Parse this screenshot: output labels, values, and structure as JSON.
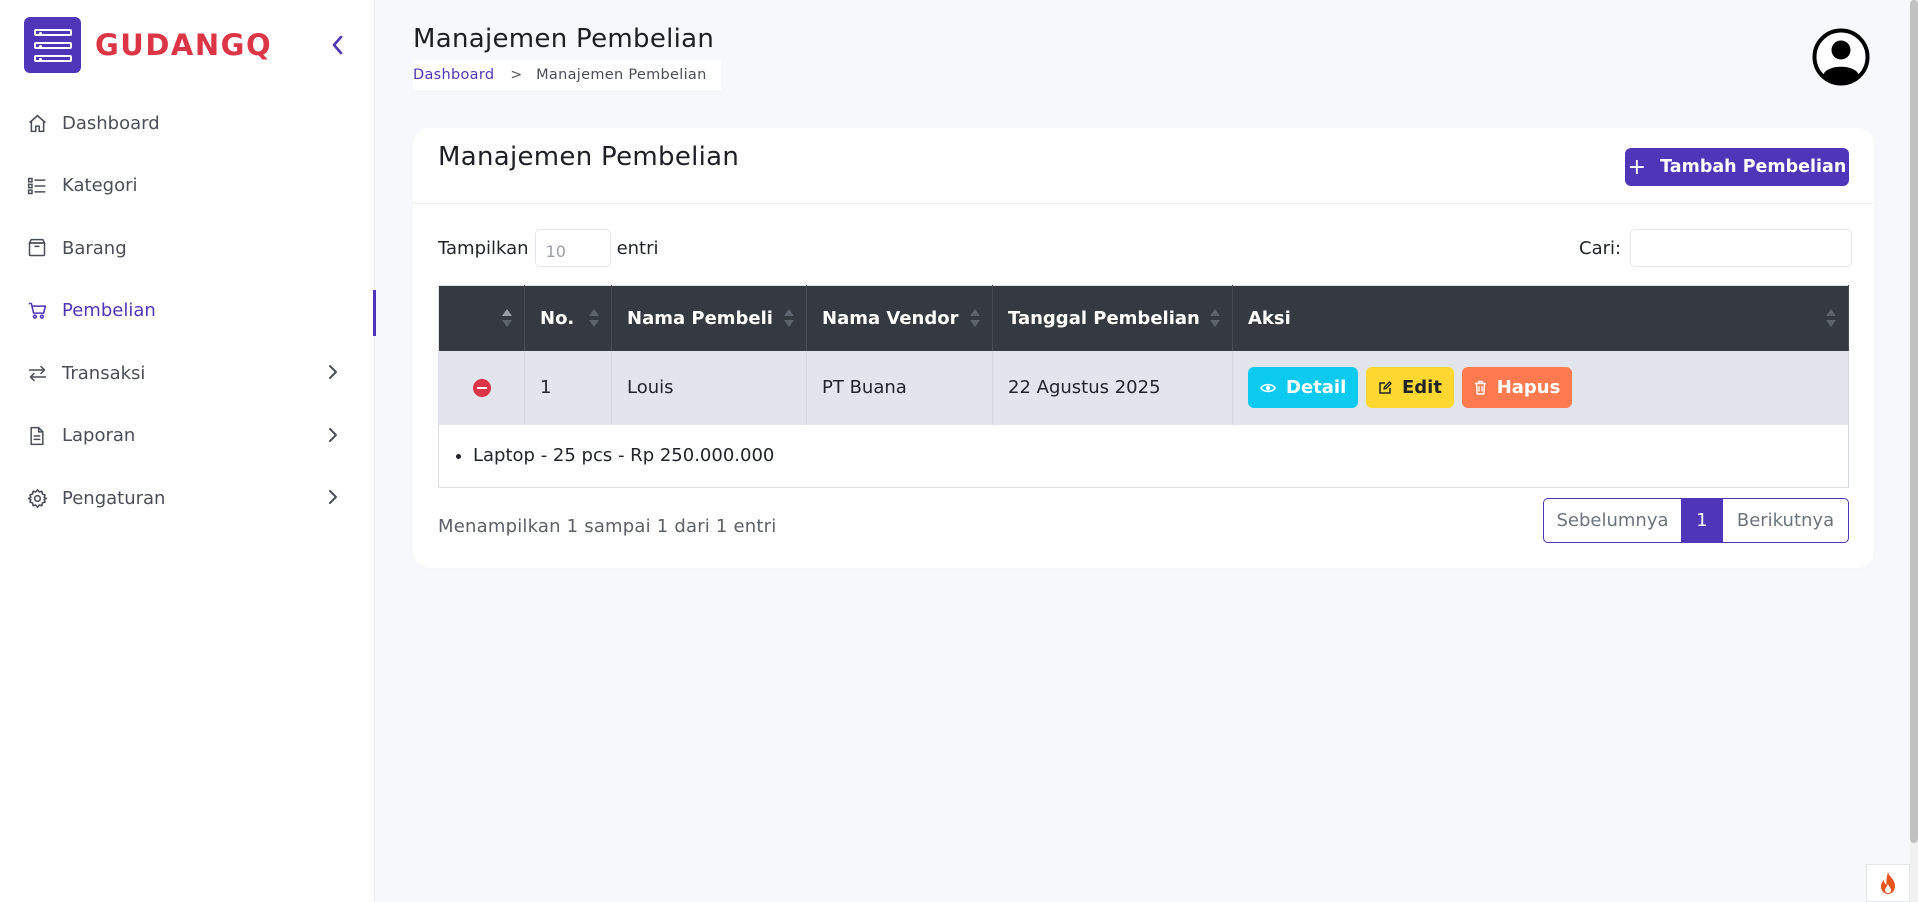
{
  "brand": {
    "name": "GUDANGQ",
    "color": "#dc3545",
    "accent": "#4f35b8"
  },
  "sidebar": {
    "items": [
      {
        "label": "Dashboard",
        "icon": "home-icon",
        "active": false,
        "has_submenu": false
      },
      {
        "label": "Kategori",
        "icon": "list-icon",
        "active": false,
        "has_submenu": false
      },
      {
        "label": "Barang",
        "icon": "box-icon",
        "active": false,
        "has_submenu": false
      },
      {
        "label": "Pembelian",
        "icon": "cart-icon",
        "active": true,
        "has_submenu": false
      },
      {
        "label": "Transaksi",
        "icon": "arrows-exchange-icon",
        "active": false,
        "has_submenu": true
      },
      {
        "label": "Laporan",
        "icon": "document-icon",
        "active": false,
        "has_submenu": true
      },
      {
        "label": "Pengaturan",
        "icon": "gear-icon",
        "active": false,
        "has_submenu": true
      }
    ]
  },
  "header": {
    "title": "Manajemen Pembelian",
    "breadcrumb": {
      "link": "Dashboard",
      "separator": ">",
      "current": "Manajemen Pembelian"
    }
  },
  "card": {
    "title": "Manajemen Pembelian",
    "add_button": "Tambah Pembelian",
    "length": {
      "prefix": "Tampilkan",
      "value": "10",
      "suffix": "entri"
    },
    "search": {
      "label": "Cari:",
      "value": ""
    },
    "table": {
      "columns": [
        "",
        "No.",
        "Nama Pembeli",
        "Nama Vendor",
        "Tanggal Pembelian",
        "Aksi"
      ],
      "rows": [
        {
          "no": "1",
          "pembeli": "Louis",
          "vendor": "PT Buana",
          "tanggal": "22 Agustus 2025",
          "expanded": true
        }
      ],
      "actions": {
        "detail": "Detail",
        "edit": "Edit",
        "hapus": "Hapus"
      },
      "child_items": [
        "Laptop - 25 pcs - Rp 250.000.000"
      ]
    },
    "info": "Menampilkan 1 sampai 1 dari 1 entri",
    "pagination": {
      "prev": "Sebelumnya",
      "current": "1",
      "next": "Berikutnya"
    }
  }
}
